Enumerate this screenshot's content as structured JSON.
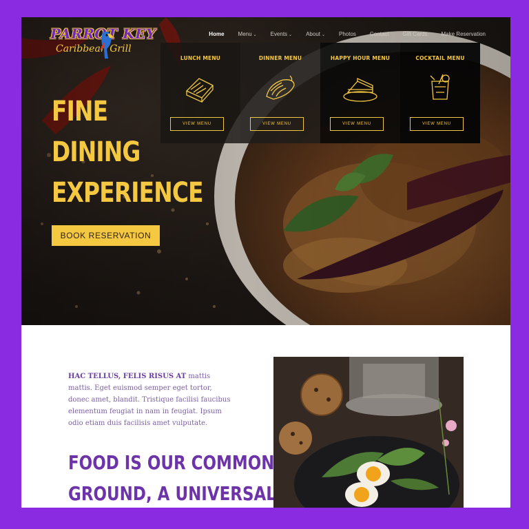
{
  "brand": {
    "name_line1": "PARROT KEY",
    "name_line2": "Caribbean Grill"
  },
  "nav": [
    {
      "label": "Home",
      "has_dropdown": false,
      "active": true
    },
    {
      "label": "Menu",
      "has_dropdown": true,
      "active": false
    },
    {
      "label": "Events",
      "has_dropdown": true,
      "active": false
    },
    {
      "label": "About",
      "has_dropdown": true,
      "active": false
    },
    {
      "label": "Photos",
      "has_dropdown": false,
      "active": false
    },
    {
      "label": "Contact",
      "has_dropdown": false,
      "active": false
    },
    {
      "label": "Gift Cards",
      "has_dropdown": false,
      "active": false
    },
    {
      "label": "Make Reservation",
      "has_dropdown": false,
      "active": false
    }
  ],
  "menus": [
    {
      "title": "LUNCH MENU",
      "button": "VIEW MENU",
      "icon": "sandwich-icon"
    },
    {
      "title": "DINNER MENU",
      "button": "VIEW MENU",
      "icon": "dinner-icon"
    },
    {
      "title": "HAPPY HOUR MENU",
      "button": "VIEW MENU",
      "icon": "cake-slice-icon"
    },
    {
      "title": "COCKTAIL MENU",
      "button": "VIEW MENU",
      "icon": "cocktail-icon"
    }
  ],
  "hero": {
    "headline": [
      "FINE",
      "DINING",
      "EXPERIENCE"
    ],
    "cta": "BOOK RESERVATION"
  },
  "intro": {
    "lead": "HAC TELLUS, FELIS RISUS AT",
    "body": " mattis mattis. Eget euismod semper eget tortor, donec amet, blandit. Tristique facilisi faucibus elementum feugiat in nam in feugiat. Ipsum odio etiam duis facilisis amet vulputate."
  },
  "section_heading": [
    "FOOD IS OUR COMMON",
    "GROUND, A UNIVERSAL"
  ],
  "colors": {
    "accent": "#f5c842",
    "purple": "#6d33a8",
    "frame": "#8a2be2"
  }
}
